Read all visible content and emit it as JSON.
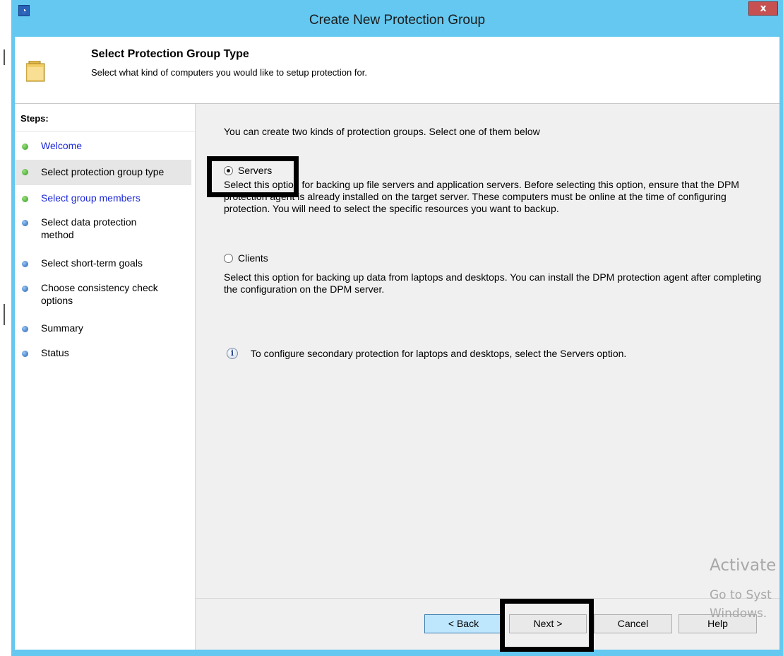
{
  "window": {
    "title": "Create New Protection Group",
    "close_glyph": "x"
  },
  "header": {
    "title": "Select Protection Group Type",
    "subtitle": "Select what kind of computers you would like to setup protection for."
  },
  "steps": {
    "heading": "Steps:",
    "items": [
      {
        "label": "Welcome",
        "status": "completed",
        "link": true
      },
      {
        "label": "Select protection group type",
        "status": "current",
        "link": false
      },
      {
        "label": "Select group members",
        "status": "pending",
        "link": true
      },
      {
        "label": "Select data protection method",
        "status": "pending",
        "link": false
      },
      {
        "label": "Select short-term goals",
        "status": "pending",
        "link": false
      },
      {
        "label": "Choose consistency check options",
        "status": "pending",
        "link": false
      },
      {
        "label": "Summary",
        "status": "pending",
        "link": false
      },
      {
        "label": "Status",
        "status": "pending",
        "link": false
      }
    ]
  },
  "main": {
    "intro": "You can create two kinds of protection groups. Select one of them below",
    "servers_option": {
      "label": "Servers",
      "selected": true,
      "description": "Select this option for backing up file servers and application servers. Before selecting this option, ensure that the DPM protection agent is already installed on the target server. These computers must be online at the time of configuring protection. You will need to select the specific resources you want to backup."
    },
    "clients_option": {
      "label": "Clients",
      "selected": false,
      "description": "Select this option for backing up data from laptops and desktops. You can install the DPM protection agent after completing the configuration on the DPM server."
    },
    "info_note": "To configure secondary protection for laptops and desktops, select the Servers option."
  },
  "buttons": {
    "back": "< Back",
    "next": "Next >",
    "cancel": "Cancel",
    "help": "Help"
  },
  "watermark": {
    "line1": "Activate",
    "line2": "Go to Syst",
    "line3": "Windows."
  },
  "colors": {
    "title_bar": "#64c8f0",
    "link": "#1c28d8",
    "completed_bullet": "#2f9a22",
    "pending_bullet": "#1f5fb0",
    "default_button": "#bee6fd"
  },
  "icons": {
    "app": "dpm-app-icon",
    "header": "folder-icon",
    "info": "info-icon"
  }
}
